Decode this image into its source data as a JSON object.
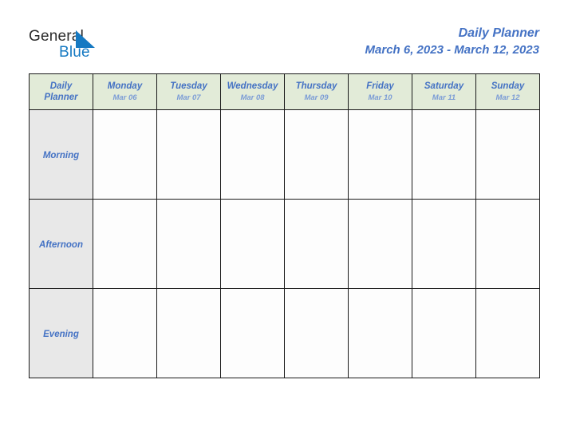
{
  "brand": {
    "name_part1": "General",
    "name_part2": "Blue",
    "triangle_icon": "triangle-icon",
    "color_dark": "#2b2b2b",
    "color_blue": "#1579c2"
  },
  "header": {
    "title": "Daily Planner",
    "date_range": "March 6, 2023 - March 12, 2023",
    "accent_color": "#4472c4"
  },
  "table": {
    "corner_label_line1": "Daily",
    "corner_label_line2": "Planner",
    "header_bg": "#e2ebd8",
    "period_bg": "#e8e8e8",
    "cell_bg": "#fdfdfd",
    "border_color": "#1a1a1a",
    "days": [
      {
        "name": "Monday",
        "date": "Mar 06"
      },
      {
        "name": "Tuesday",
        "date": "Mar 07"
      },
      {
        "name": "Wednesday",
        "date": "Mar 08"
      },
      {
        "name": "Thursday",
        "date": "Mar 09"
      },
      {
        "name": "Friday",
        "date": "Mar 10"
      },
      {
        "name": "Saturday",
        "date": "Mar 11"
      },
      {
        "name": "Sunday",
        "date": "Mar 12"
      }
    ],
    "periods": [
      {
        "label": "Morning",
        "entries": [
          "",
          "",
          "",
          "",
          "",
          "",
          ""
        ]
      },
      {
        "label": "Afternoon",
        "entries": [
          "",
          "",
          "",
          "",
          "",
          "",
          ""
        ]
      },
      {
        "label": "Evening",
        "entries": [
          "",
          "",
          "",
          "",
          "",
          "",
          ""
        ]
      }
    ]
  }
}
